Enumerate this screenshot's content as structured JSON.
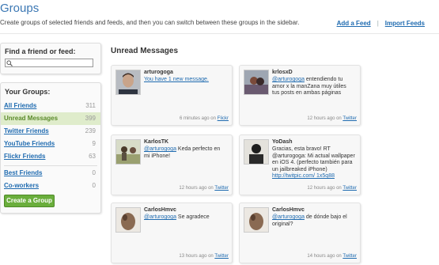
{
  "header": {
    "title": "Groups",
    "subtitle": "Create groups of selected friends and feeds, and then you can switch between these groups in the sidebar.",
    "add_feed": "Add a Feed",
    "separator": "|",
    "import_feeds": "Import Feeds"
  },
  "find": {
    "label": "Find a friend or feed:",
    "value": "",
    "placeholder": ""
  },
  "groups": {
    "heading": "Your Groups:",
    "items": [
      {
        "name": "All Friends",
        "count": "311"
      },
      {
        "name": "Unread Messages",
        "count": "399"
      },
      {
        "name": "Twitter Friends",
        "count": "239"
      },
      {
        "name": "YouTube Friends",
        "count": "9"
      },
      {
        "name": "Flickr Friends",
        "count": "63"
      }
    ],
    "custom": [
      {
        "name": "Best Friends",
        "count": "0"
      },
      {
        "name": "Co-workers",
        "count": "0"
      }
    ],
    "create_label": "Create a Group"
  },
  "main": {
    "heading": "Unread Messages",
    "messages": [
      {
        "user": "arturogoga",
        "mention": "",
        "text": "You have 1 new message.",
        "time": "6 minutes ago on",
        "source": "Flickr"
      },
      {
        "user": "krlosxD",
        "mention": "@arturogoga",
        "text": " entendiendo tu amor x la manZana muy útiles tus posts en ambas páginas",
        "time": "12 hours ago on",
        "source": "Twitter"
      },
      {
        "user": "KarlosTK",
        "mention": "@arturogoga",
        "text": " Keda perfecto en mi iPhone!",
        "time": "12 hours ago on",
        "source": "Twitter"
      },
      {
        "user": "YoDash",
        "mention": "",
        "text": "Gracias, esta bravo! RT @arturogoga: Mi actual wallpaper en iOS 4. (perfecto también para un jailbreaked iPhone)",
        "link": "http://twitpic.com/ 1x5q88",
        "time": "12 hours ago on",
        "source": "Twitter"
      },
      {
        "user": "CarlosHmvc",
        "mention": "@arturogoga",
        "text": " Se agradece",
        "time": "13 hours ago on",
        "source": "Twitter"
      },
      {
        "user": "CarlosHmvc",
        "mention": "@arturogoga",
        "text": " de dónde bajo el original?",
        "time": "14 hours ago on",
        "source": "Twitter"
      }
    ]
  }
}
